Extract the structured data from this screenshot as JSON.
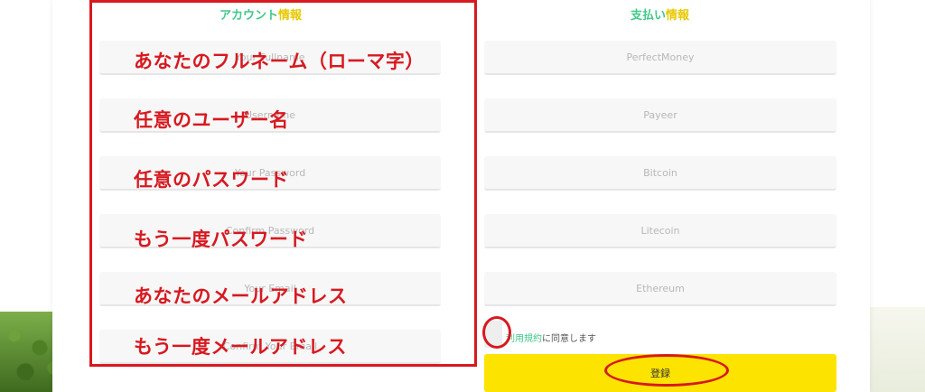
{
  "account_section": {
    "title_green": "アカウント",
    "title_yellow": "情報",
    "fields": [
      {
        "placeholder": "Your Fullname"
      },
      {
        "placeholder": "Username"
      },
      {
        "placeholder": "Your Password"
      },
      {
        "placeholder": "Confirm Password"
      },
      {
        "placeholder": "Your Email"
      },
      {
        "placeholder": "Confirm Your Email"
      }
    ]
  },
  "payment_section": {
    "title_green": "支払い",
    "title_yellow": "情報",
    "fields": [
      {
        "placeholder": "PerfectMoney"
      },
      {
        "placeholder": "Payeer"
      },
      {
        "placeholder": "Bitcoin"
      },
      {
        "placeholder": "Litecoin"
      },
      {
        "placeholder": "Ethereum"
      }
    ]
  },
  "terms": {
    "link_text": "利用規約",
    "suffix_text": "に同意します"
  },
  "register_button": {
    "label": "登録"
  },
  "annotations": {
    "color": "#d71920",
    "labels": [
      "あなたのフルネーム（ローマ字）",
      "任意のユーザー名",
      "任意のパスワード",
      "もう一度パスワード",
      "あなたのメールアドレス",
      "もう一度メールアドレス"
    ]
  },
  "colors": {
    "accent_green": "#42c88a",
    "accent_yellow": "#e8c800",
    "button_yellow": "#fde300"
  }
}
